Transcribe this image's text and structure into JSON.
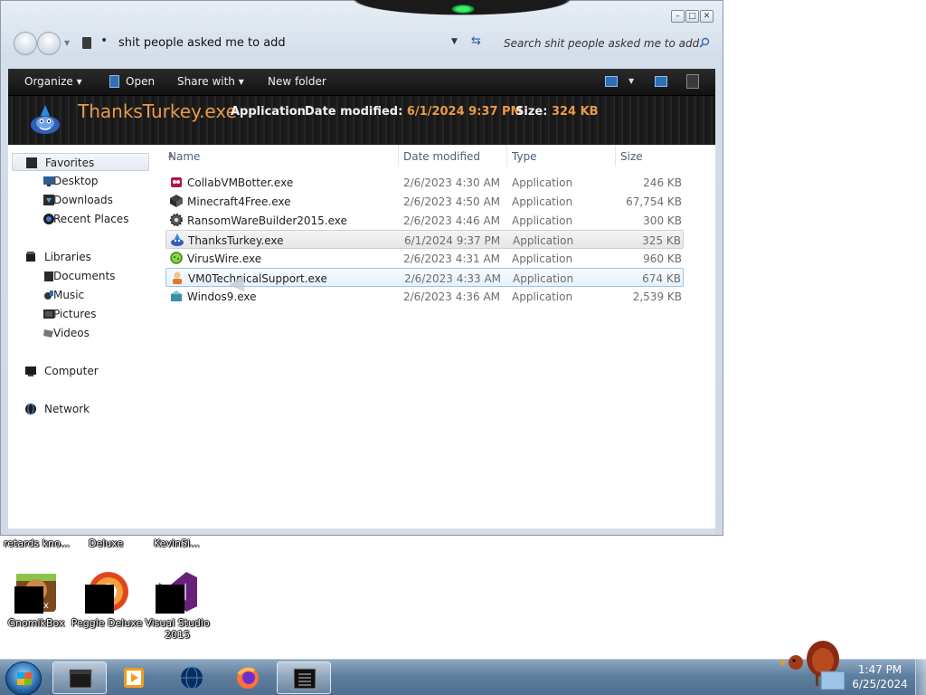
{
  "window": {
    "address": "shit people asked me to add",
    "search_placeholder": "Search shit people asked me to add"
  },
  "commandbar": {
    "organize": "Organize",
    "open": "Open",
    "share_with": "Share with",
    "new_folder": "New folder"
  },
  "details": {
    "name": "ThanksTurkey.exe",
    "type": "Application",
    "date_label": "Date modified:",
    "date_value": "6/1/2024 9:37 PM",
    "size_label": "Size:",
    "size_value": "324 KB"
  },
  "nav_pane": {
    "favorites": "Favorites",
    "desktop": "Desktop",
    "downloads": "Downloads",
    "recent_places": "Recent Places",
    "libraries": "Libraries",
    "documents": "Documents",
    "music": "Music",
    "pictures": "Pictures",
    "videos": "Videos",
    "computer": "Computer",
    "network": "Network"
  },
  "columns": {
    "name": "Name",
    "date_modified": "Date modified",
    "type": "Type",
    "size": "Size"
  },
  "files": [
    {
      "name": "CollabVMBotter.exe",
      "date": "2/6/2023 4:30 AM",
      "type": "Application",
      "size": "246 KB",
      "icon": "bot-icon"
    },
    {
      "name": "Minecraft4Free.exe",
      "date": "2/6/2023 4:50 AM",
      "type": "Application",
      "size": "67,754 KB",
      "icon": "minecraft-icon"
    },
    {
      "name": "RansomWareBuilder2015.exe",
      "date": "2/6/2023 4:46 AM",
      "type": "Application",
      "size": "300 KB",
      "icon": "gear-icon"
    },
    {
      "name": "ThanksTurkey.exe",
      "date": "6/1/2024 9:37 PM",
      "type": "Application",
      "size": "325 KB",
      "icon": "turkey-app-icon"
    },
    {
      "name": "VirusWire.exe",
      "date": "2/6/2023 4:31 AM",
      "type": "Application",
      "size": "960 KB",
      "icon": "virus-icon"
    },
    {
      "name": "VM0TechnicalSupport.exe",
      "date": "2/6/2023 4:33 AM",
      "type": "Application",
      "size": "674 KB",
      "icon": "support-person-icon"
    },
    {
      "name": "Windos9.exe",
      "date": "2/6/2023 4:36 AM",
      "type": "Application",
      "size": "2,539 KB",
      "icon": "windows-box-icon"
    }
  ],
  "desktop": {
    "partial_labels": [
      "retards kno...",
      "Deluxe",
      "KevinSi..."
    ],
    "icons": [
      {
        "label": "GnomikBox"
      },
      {
        "label": "Peggle Deluxe"
      },
      {
        "label": "Visual Studio 2015"
      }
    ]
  },
  "taskbar": {
    "time": "1:47 PM",
    "date": "6/25/2024"
  },
  "colors": {
    "accent_orange": "#e89a4a",
    "selection_blue": "#9dc3e6",
    "command_bar": "#1c1c1c"
  }
}
